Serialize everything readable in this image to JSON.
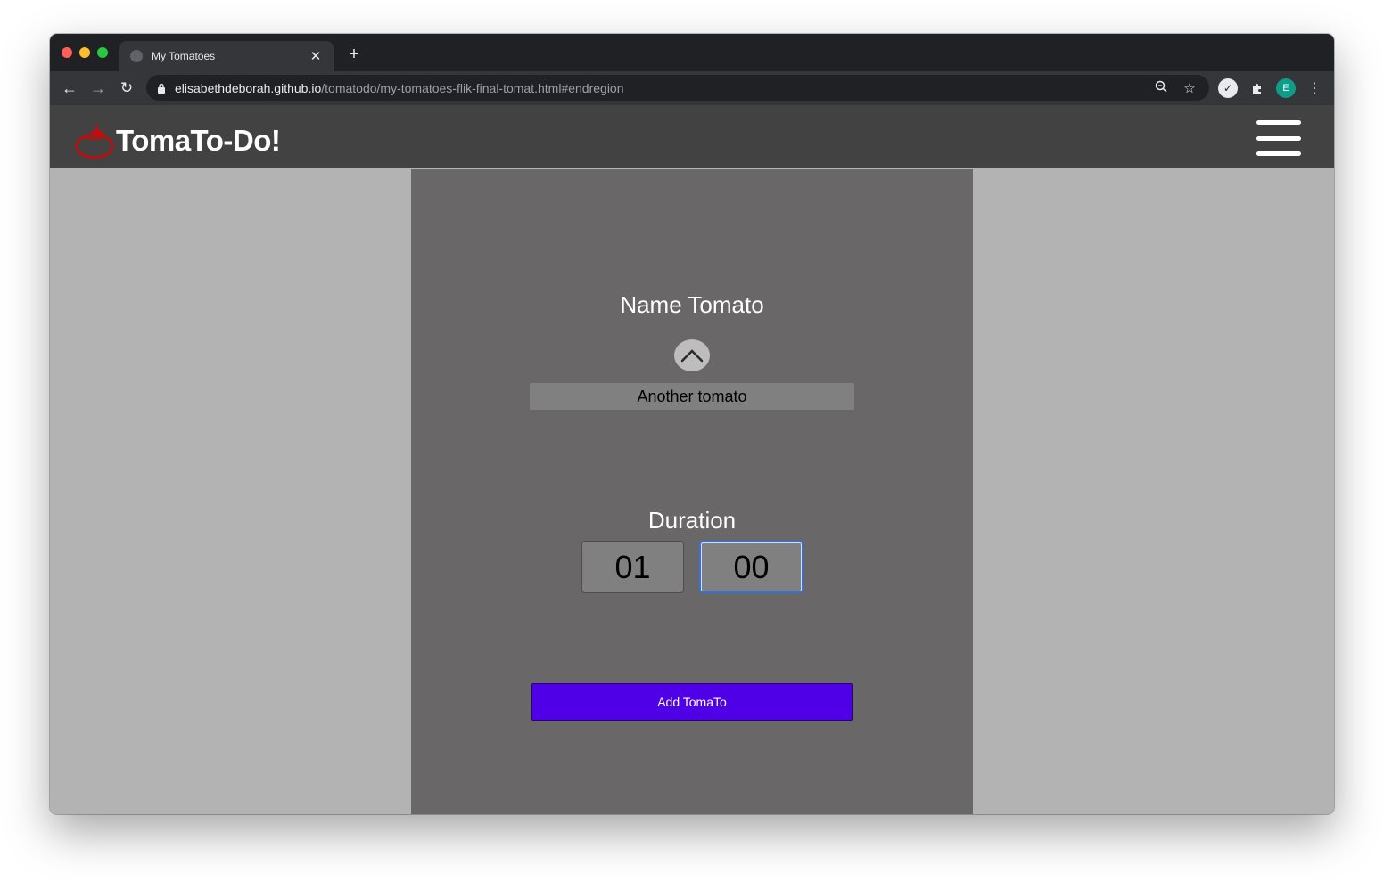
{
  "browser": {
    "tab": {
      "title": "My Tomatoes",
      "close_icon": "close-icon"
    },
    "new_tab_label": "+",
    "address": {
      "host": "elisabethdeborah.github.io",
      "path": "/tomatodo/my-tomatoes-flik-final-tomat.html#endregion"
    },
    "profile_initial": "E"
  },
  "app": {
    "title": "TomaTo-Do!",
    "brand_color": "#e00000"
  },
  "form": {
    "name_label": "Name Tomato",
    "name_value": "Another tomato",
    "duration_label": "Duration",
    "hours_value": "01",
    "minutes_value": "00",
    "submit_label": "Add TomaTo",
    "submit_color": "#5000e6"
  }
}
